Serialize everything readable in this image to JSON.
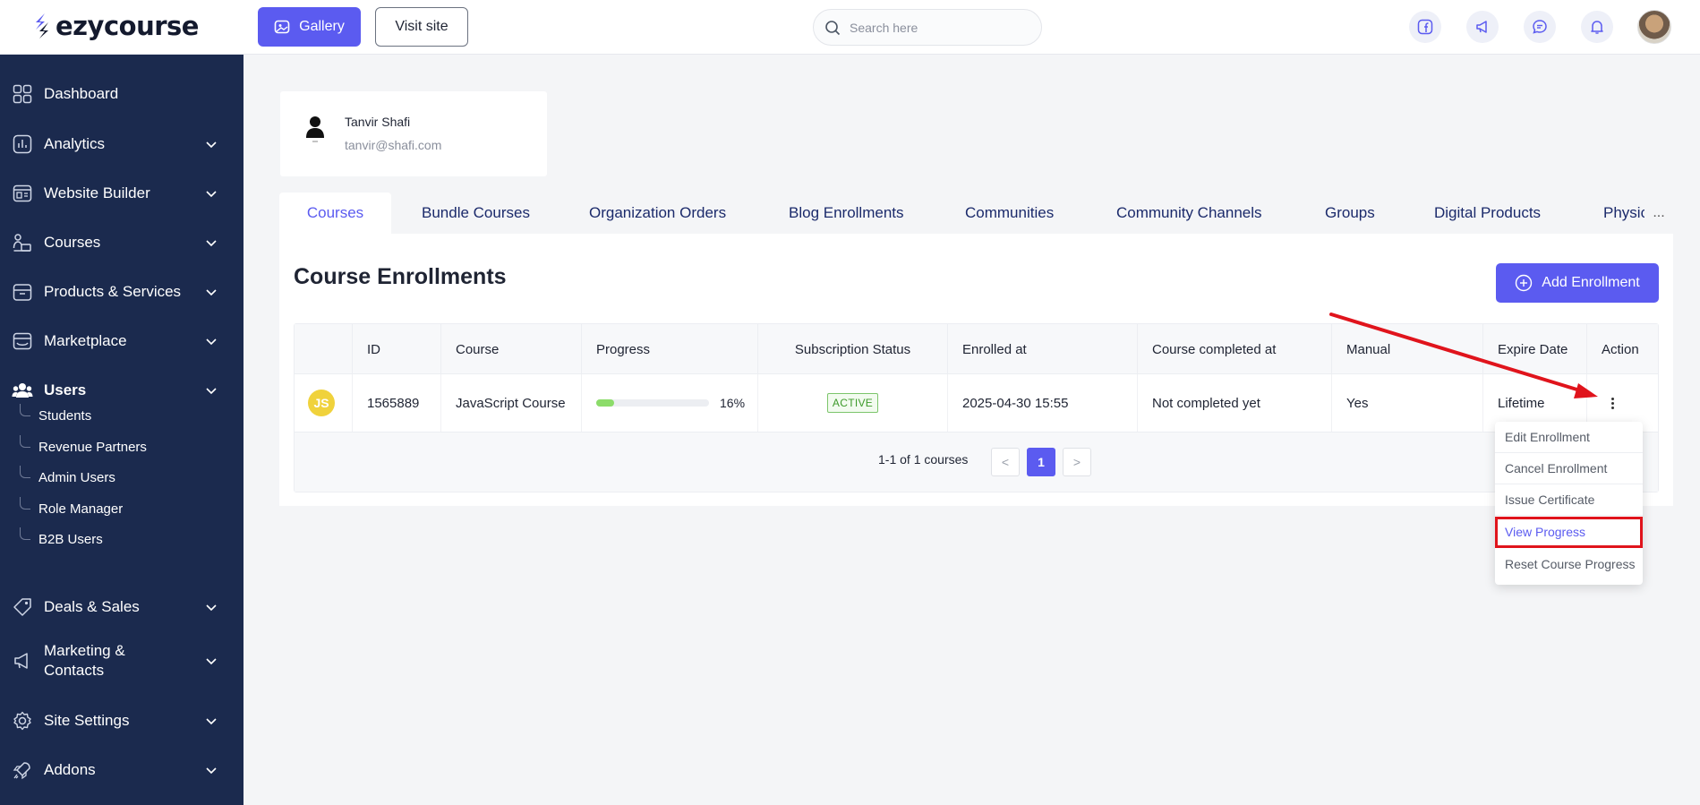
{
  "app": {
    "logo_text": "ezycourse"
  },
  "topbar": {
    "gallery_label": "Gallery",
    "visit_site_label": "Visit site",
    "search_placeholder": "Search here",
    "icons": [
      "facebook-icon",
      "megaphone-icon",
      "chat-icon",
      "bell-icon"
    ]
  },
  "sidebar": {
    "items": [
      {
        "label": "Dashboard",
        "icon": "dashboard-icon"
      },
      {
        "label": "Analytics",
        "icon": "analytics-icon"
      },
      {
        "label": "Website Builder",
        "icon": "website-builder-icon"
      },
      {
        "label": "Courses",
        "icon": "courses-icon"
      },
      {
        "label": "Products & Services",
        "icon": "products-icon"
      },
      {
        "label": "Marketplace",
        "icon": "marketplace-icon"
      },
      {
        "label": "Users",
        "icon": "users-icon"
      },
      {
        "label": "Deals & Sales",
        "icon": "tag-icon"
      },
      {
        "label": "Marketing & Contacts",
        "icon": "megaphone-icon"
      },
      {
        "label": "Site Settings",
        "icon": "gear-icon"
      },
      {
        "label": "Addons",
        "icon": "rocket-icon"
      }
    ],
    "users_sub": [
      {
        "label": "Students"
      },
      {
        "label": "Revenue Partners"
      },
      {
        "label": "Admin Users"
      },
      {
        "label": "Role Manager"
      },
      {
        "label": "B2B Users"
      }
    ]
  },
  "user": {
    "name": "Tanvir Shafi",
    "email": "tanvir@shafi.com"
  },
  "tabs": [
    {
      "label": "Courses"
    },
    {
      "label": "Bundle Courses"
    },
    {
      "label": "Organization Orders"
    },
    {
      "label": "Blog Enrollments"
    },
    {
      "label": "Communities"
    },
    {
      "label": "Community Channels"
    },
    {
      "label": "Groups"
    },
    {
      "label": "Digital Products"
    },
    {
      "label": "Physical Products"
    }
  ],
  "tabs_more": "...",
  "panel": {
    "title": "Course Enrollments",
    "add_label": "Add Enrollment"
  },
  "table": {
    "headers": [
      "",
      "ID",
      "Course",
      "Progress",
      "Subscription Status",
      "Enrolled at",
      "Course completed at",
      "Manual",
      "Expire Date",
      "Action"
    ],
    "rows": [
      {
        "badge": "JS",
        "id": "1565889",
        "course": "JavaScript Course",
        "progress": 0.16,
        "progress_label": "16%",
        "status": "ACTIVE",
        "enrolled_at": "2025-04-30 15:55",
        "completed_at": "Not completed yet",
        "manual": "Yes",
        "expire": "Lifetime"
      }
    ],
    "pagination": {
      "summary": "1-1 of 1 courses",
      "prev": "<",
      "page": "1",
      "next": ">"
    }
  },
  "action_menu": {
    "items": [
      {
        "label": "Edit Enrollment"
      },
      {
        "label": "Cancel Enrollment"
      },
      {
        "label": "Issue Certificate"
      },
      {
        "label": "View Progress"
      },
      {
        "label": "Reset Course Progress"
      }
    ],
    "highlighted": "View Progress"
  },
  "colors": {
    "primary": "#5b5bf0",
    "sidebar": "#1b2a4e",
    "annotation": "#e0141c"
  }
}
